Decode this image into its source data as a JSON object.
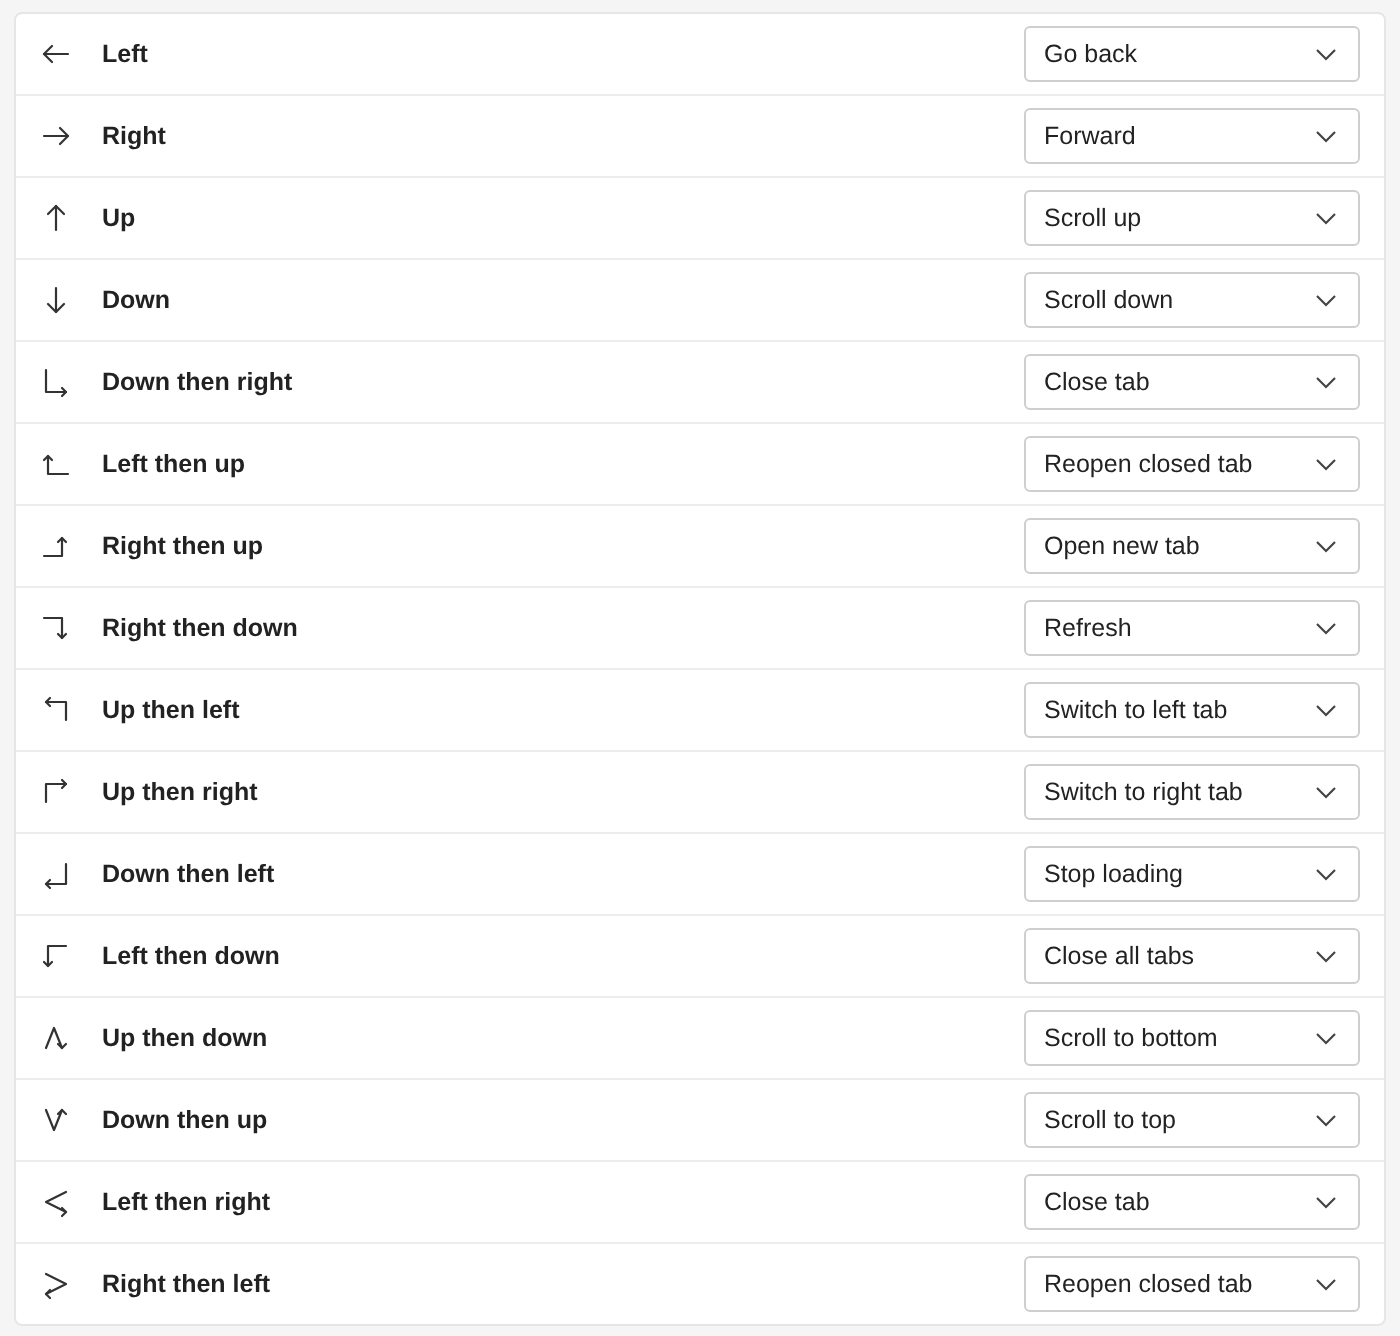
{
  "gestures": [
    {
      "kind": "left",
      "label": "Left",
      "action": "Go back"
    },
    {
      "kind": "right",
      "label": "Right",
      "action": "Forward"
    },
    {
      "kind": "up",
      "label": "Up",
      "action": "Scroll up"
    },
    {
      "kind": "down",
      "label": "Down",
      "action": "Scroll down"
    },
    {
      "kind": "downright",
      "label": "Down then right",
      "action": "Close tab"
    },
    {
      "kind": "leftup",
      "label": "Left then up",
      "action": "Reopen closed tab"
    },
    {
      "kind": "rightup",
      "label": "Right then up",
      "action": "Open new tab"
    },
    {
      "kind": "rightdown",
      "label": "Right then down",
      "action": "Refresh"
    },
    {
      "kind": "upleft",
      "label": "Up then left",
      "action": "Switch to left tab"
    },
    {
      "kind": "upright",
      "label": "Up then right",
      "action": "Switch to right tab"
    },
    {
      "kind": "downleft",
      "label": "Down then left",
      "action": "Stop loading"
    },
    {
      "kind": "leftdown",
      "label": "Left then down",
      "action": "Close all tabs"
    },
    {
      "kind": "updown",
      "label": "Up then down",
      "action": "Scroll to bottom"
    },
    {
      "kind": "downup",
      "label": "Down then up",
      "action": "Scroll to top"
    },
    {
      "kind": "leftright",
      "label": "Left then right",
      "action": "Close tab"
    },
    {
      "kind": "rightleft",
      "label": "Right then left",
      "action": "Reopen closed tab"
    }
  ]
}
